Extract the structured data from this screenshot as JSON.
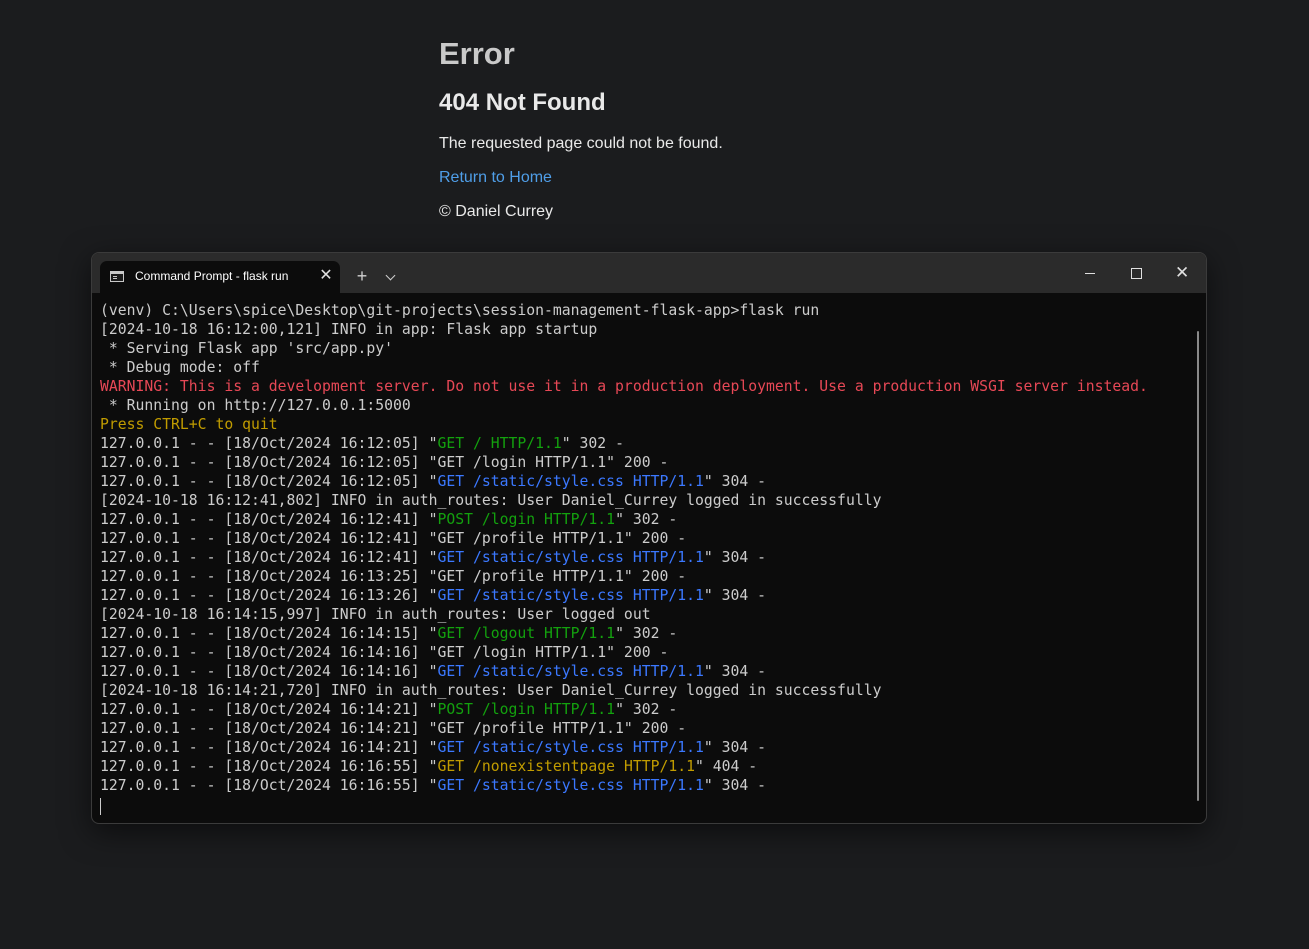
{
  "webpage": {
    "heading": "Error",
    "subheading": "404 Not Found",
    "message": "The requested page could not be found.",
    "home_link": "Return to Home",
    "footer": "© Daniel Currey"
  },
  "terminal": {
    "tab_title": "Command Prompt - flask  run",
    "new_tab_symbol": "+",
    "close_tab_symbol": "✕",
    "close_window_symbol": "✕",
    "icons": {
      "tab": "command-prompt-icon",
      "new_tab": "plus-icon",
      "dropdown": "chevron-down-icon",
      "minimize": "minimize-icon",
      "maximize": "maximize-icon",
      "close": "close-icon"
    },
    "colors": {
      "background": "#0c0c0c",
      "text": "#cccccc",
      "warning": "#e74856",
      "notice": "#c19c00",
      "success": "#13a10e",
      "info": "#3b78ff"
    },
    "lines": [
      [
        {
          "t": "(venv) C:\\Users\\spice\\Desktop\\git-projects\\session-management-flask-app>flask run"
        }
      ],
      [
        {
          "t": "[2024-10-18 16:12:00,121] INFO in app: Flask app startup"
        }
      ],
      [
        {
          "t": " * Serving Flask app 'src/app.py'"
        }
      ],
      [
        {
          "t": " * Debug mode: off"
        }
      ],
      [
        {
          "t": "WARNING: This is a development server. Do not use it in a production deployment. Use a production WSGI server instead.",
          "c": "red"
        }
      ],
      [
        {
          "t": " * Running on http://127.0.0.1:5000"
        }
      ],
      [
        {
          "t": "Press CTRL+C to quit",
          "c": "yellow"
        }
      ],
      [
        {
          "t": "127.0.0.1 - - [18/Oct/2024 16:12:05] \""
        },
        {
          "t": "GET / HTTP/1.1",
          "c": "green"
        },
        {
          "t": "\" 302 -"
        }
      ],
      [
        {
          "t": "127.0.0.1 - - [18/Oct/2024 16:12:05] \"GET /login HTTP/1.1\" 200 -"
        }
      ],
      [
        {
          "t": "127.0.0.1 - - [18/Oct/2024 16:12:05] \""
        },
        {
          "t": "GET /static/style.css HTTP/1.1",
          "c": "blue"
        },
        {
          "t": "\" 304 -"
        }
      ],
      [
        {
          "t": "[2024-10-18 16:12:41,802] INFO in auth_routes: User Daniel_Currey logged in successfully"
        }
      ],
      [
        {
          "t": "127.0.0.1 - - [18/Oct/2024 16:12:41] \""
        },
        {
          "t": "POST /login HTTP/1.1",
          "c": "green"
        },
        {
          "t": "\" 302 -"
        }
      ],
      [
        {
          "t": "127.0.0.1 - - [18/Oct/2024 16:12:41] \"GET /profile HTTP/1.1\" 200 -"
        }
      ],
      [
        {
          "t": "127.0.0.1 - - [18/Oct/2024 16:12:41] \""
        },
        {
          "t": "GET /static/style.css HTTP/1.1",
          "c": "blue"
        },
        {
          "t": "\" 304 -"
        }
      ],
      [
        {
          "t": "127.0.0.1 - - [18/Oct/2024 16:13:25] \"GET /profile HTTP/1.1\" 200 -"
        }
      ],
      [
        {
          "t": "127.0.0.1 - - [18/Oct/2024 16:13:26] \""
        },
        {
          "t": "GET /static/style.css HTTP/1.1",
          "c": "blue"
        },
        {
          "t": "\" 304 -"
        }
      ],
      [
        {
          "t": "[2024-10-18 16:14:15,997] INFO in auth_routes: User logged out"
        }
      ],
      [
        {
          "t": "127.0.0.1 - - [18/Oct/2024 16:14:15] \""
        },
        {
          "t": "GET /logout HTTP/1.1",
          "c": "green"
        },
        {
          "t": "\" 302 -"
        }
      ],
      [
        {
          "t": "127.0.0.1 - - [18/Oct/2024 16:14:16] \"GET /login HTTP/1.1\" 200 -"
        }
      ],
      [
        {
          "t": "127.0.0.1 - - [18/Oct/2024 16:14:16] \""
        },
        {
          "t": "GET /static/style.css HTTP/1.1",
          "c": "blue"
        },
        {
          "t": "\" 304 -"
        }
      ],
      [
        {
          "t": "[2024-10-18 16:14:21,720] INFO in auth_routes: User Daniel_Currey logged in successfully"
        }
      ],
      [
        {
          "t": "127.0.0.1 - - [18/Oct/2024 16:14:21] \""
        },
        {
          "t": "POST /login HTTP/1.1",
          "c": "green"
        },
        {
          "t": "\" 302 -"
        }
      ],
      [
        {
          "t": "127.0.0.1 - - [18/Oct/2024 16:14:21] \"GET /profile HTTP/1.1\" 200 -"
        }
      ],
      [
        {
          "t": "127.0.0.1 - - [18/Oct/2024 16:14:21] \""
        },
        {
          "t": "GET /static/style.css HTTP/1.1",
          "c": "blue"
        },
        {
          "t": "\" 304 -"
        }
      ],
      [
        {
          "t": "127.0.0.1 - - [18/Oct/2024 16:16:55] \""
        },
        {
          "t": "GET /nonexistentpage HTTP/1.1",
          "c": "yellow"
        },
        {
          "t": "\" 404 -"
        }
      ],
      [
        {
          "t": "127.0.0.1 - - [18/Oct/2024 16:16:55] \""
        },
        {
          "t": "GET /static/style.css HTTP/1.1",
          "c": "blue"
        },
        {
          "t": "\" 304 -"
        }
      ]
    ]
  }
}
